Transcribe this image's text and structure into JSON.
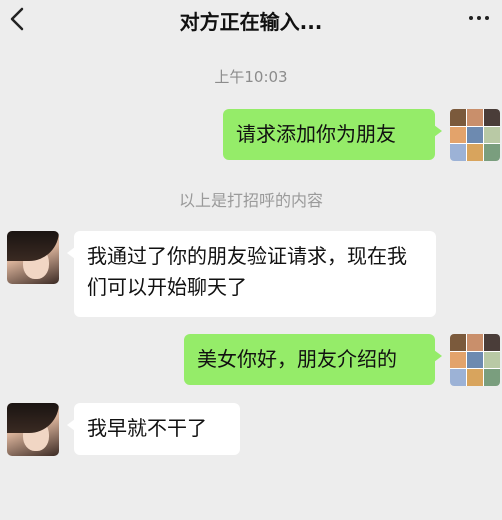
{
  "header": {
    "title": "对方正在输入...",
    "back_icon": "chevron-left-icon",
    "more_icon": "more-horizontal-icon"
  },
  "chat": {
    "timestamp": "上午10:03",
    "system_note": "以上是打招呼的内容",
    "messages": [
      {
        "side": "right",
        "text": "请求添加你为朋友"
      },
      {
        "side": "left",
        "text": "我通过了你的朋友验证请求，现在我们可以开始聊天了"
      },
      {
        "side": "right",
        "text": "美女你好，朋友介绍的"
      },
      {
        "side": "left",
        "text": "我早就不干了"
      }
    ]
  },
  "colors": {
    "background": "#ededed",
    "outgoing_bubble": "#95ec69",
    "incoming_bubble": "#ffffff"
  }
}
